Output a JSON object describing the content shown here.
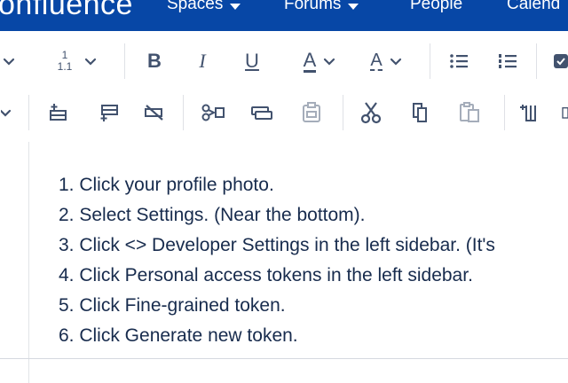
{
  "topnav": {
    "brand": "onfluence",
    "items": [
      {
        "label": "Spaces",
        "has_caret": true
      },
      {
        "label": "Forums",
        "has_caret": true
      },
      {
        "label": "People",
        "has_caret": false
      },
      {
        "label": "Calend",
        "has_caret": false
      }
    ],
    "background": "#0747a6"
  },
  "toolbar": {
    "row1": [
      {
        "name": "paragraph-style-chevron-icon"
      },
      {
        "name": "line-spacing-icon",
        "top": "1",
        "bottom": "1.1"
      },
      {
        "name": "bold-icon",
        "glyph": "B"
      },
      {
        "name": "italic-icon",
        "glyph": "I"
      },
      {
        "name": "underline-icon",
        "glyph": "U"
      },
      {
        "name": "text-color-icon",
        "glyph": "A"
      },
      {
        "name": "clear-formatting-icon",
        "glyph": "A"
      },
      {
        "name": "bullet-list-icon"
      },
      {
        "name": "numbered-list-icon"
      },
      {
        "name": "task-list-icon"
      }
    ],
    "row2": [
      {
        "name": "table-insert-row-before-icon"
      },
      {
        "name": "table-insert-row-after-icon"
      },
      {
        "name": "table-delete-row-icon"
      },
      {
        "name": "table-cut-row-icon"
      },
      {
        "name": "table-copy-row-icon"
      },
      {
        "name": "table-paste-row-icon",
        "disabled": true
      },
      {
        "name": "cut-icon"
      },
      {
        "name": "copy-icon"
      },
      {
        "name": "paste-icon",
        "disabled": true
      },
      {
        "name": "delete-column-icon"
      }
    ]
  },
  "content": {
    "steps": [
      "1. Click your profile photo.",
      "2. Select Settings. (Near the bottom).",
      "3. Click <> Developer Settings in the left sidebar. (It's",
      "4. Click Personal access tokens in the left sidebar.",
      "5. Click Fine-grained token.",
      "6. Click Generate new token."
    ]
  }
}
